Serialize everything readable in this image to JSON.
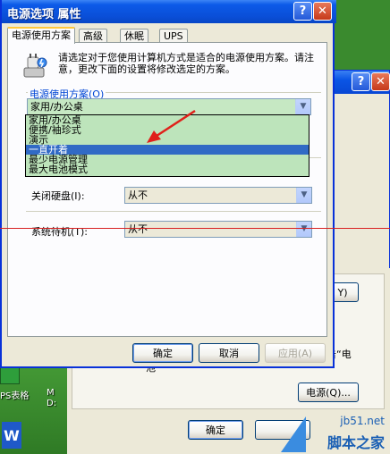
{
  "dialog": {
    "title": "电源选项 属性",
    "tabs": [
      {
        "label": "电源使用方案"
      },
      {
        "label": "高级"
      },
      {
        "label": "休眠"
      },
      {
        "label": "UPS"
      }
    ],
    "intro_text": "请选定对于您使用计算机方式是适合的电源使用方案。请注意，更改下面的设置将修改选定的方案。",
    "scheme_group_label": "电源使用方案(O)",
    "scheme_selected": "家用/办公桌",
    "scheme_options": [
      "家用/办公桌",
      "便携/袖珍式",
      "演示",
      "一直开着",
      "最少电源管理",
      "最大电池模式"
    ],
    "scheme_highlighted": "一直开着",
    "hard_disk_label": "关闭硬盘(I):",
    "hard_disk_value": "从不",
    "standby_label": "系统待机(T):",
    "standby_value": "从不",
    "ok_label": "确定",
    "cancel_label": "取消",
    "apply_label": "应用(A)"
  },
  "back_window": {
    "partial_text": "击“电",
    "partial_text2": "池",
    "button_partial": "Y)",
    "power_button_label": "电源(Q)...",
    "ok_label": "确定"
  },
  "desktop": {
    "icon_label_left": "PS表格",
    "icon_label_right": "M D:",
    "taskbar_tile": "W"
  },
  "watermark": {
    "url": "jb51.net",
    "name": "脚本之家"
  },
  "colors": {
    "titlebar_blue": "#0a55e5",
    "dropdown_green": "#bde4bb",
    "selection_blue": "#316ac5",
    "arrow_red": "#e0201a"
  }
}
